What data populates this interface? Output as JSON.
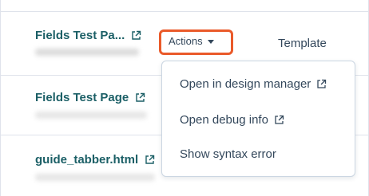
{
  "rows": [
    {
      "title": "Fields Test Pa...",
      "icon": "external-link-icon"
    },
    {
      "title": "Fields Test Page",
      "icon": "external-link-icon"
    },
    {
      "title": "guide_tabber.html",
      "icon": "external-link-icon"
    }
  ],
  "actions": {
    "label": "Actions",
    "icon": "caret-down-icon",
    "highlight_color": "#ea5a2a"
  },
  "column_header": "Template",
  "menu": {
    "items": [
      {
        "label": "Open in design manager",
        "icon": "external-link-icon"
      },
      {
        "label": "Open debug info",
        "icon": "external-link-icon"
      },
      {
        "label": "Show syntax error"
      }
    ]
  },
  "colors": {
    "link": "#1b5f66",
    "text": "#33475b",
    "border": "#dfe3eb"
  }
}
